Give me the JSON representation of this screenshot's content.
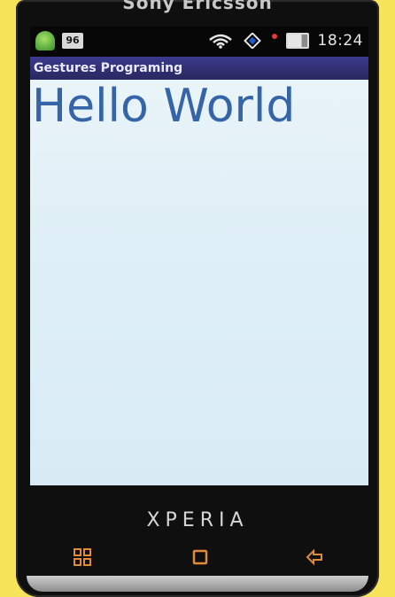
{
  "device": {
    "brand_text": "Sony Ericsson",
    "model_text": "XPERIA"
  },
  "statusbar": {
    "sd_label": "96",
    "time": "18:24",
    "icons": [
      "android-icon",
      "sd-card-icon",
      "wifi-icon",
      "rotate-icon",
      "alert-dot-icon",
      "battery-icon"
    ]
  },
  "app": {
    "title": "Gestures Programing",
    "main_text": "Hello World"
  },
  "navigation": {
    "buttons": [
      "menu-icon",
      "home-icon",
      "back-icon"
    ]
  },
  "colors": {
    "background": "#f7e45a",
    "title_bar": "#2f2e6e",
    "hello_text": "#3564a8",
    "content_bg": "#e3f1f7",
    "nav_buttons": "#e08a3a"
  }
}
